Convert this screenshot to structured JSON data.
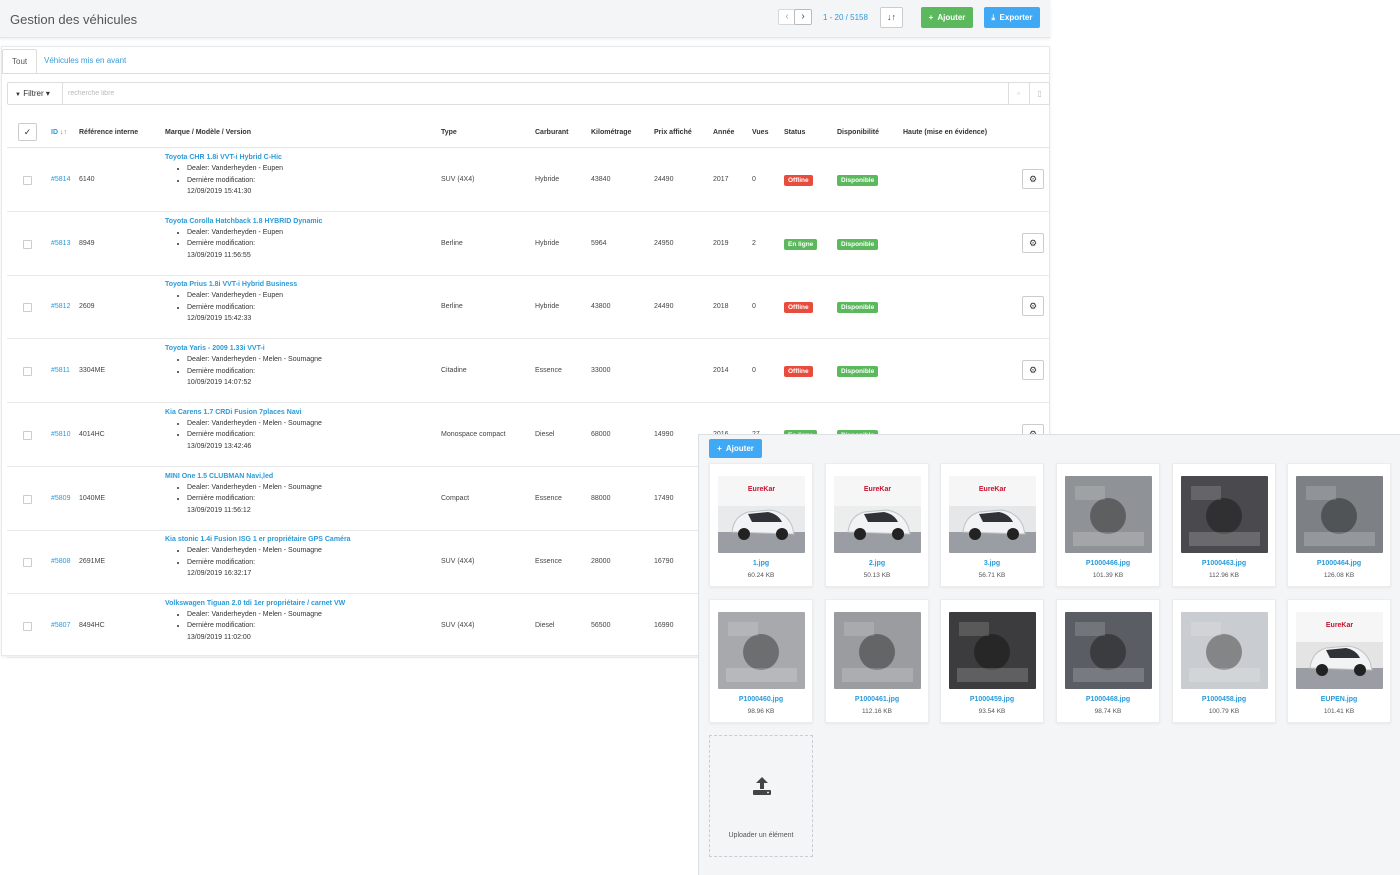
{
  "header": {
    "title": "Gestion des véhicules",
    "prev_icon": "chevron-left-icon",
    "next_icon": "chevron-right-icon",
    "prev_glyph": "‹",
    "next_glyph": "›",
    "pager_text": "1 - 20 / 5158",
    "sort_glyph": "↓↑",
    "add_label": "Ajouter",
    "export_label": "Exporter",
    "add_glyph": "+",
    "export_glyph": "⤓",
    "colors": {
      "green": "#5cb85c",
      "blue": "#3fa9f5",
      "link": "#2b9ad8",
      "red": "#e84c3d"
    }
  },
  "tabs": [
    {
      "label": "Tout",
      "active": true
    },
    {
      "label": "Véhicules mis en avant",
      "active": false
    }
  ],
  "filter": {
    "button_label": "Filtrer",
    "filter_glyph": "▼",
    "caret": "▾",
    "placeholder": "recherche libre",
    "save_glyph": "▫",
    "trash_glyph": "▯"
  },
  "table": {
    "check_glyph": "✓",
    "columns": {
      "id": "ID",
      "id_sort": "↓↑",
      "ref": "Référence interne",
      "model": "Marque / Modèle / Version",
      "type": "Type",
      "fuel": "Carburant",
      "km": "Kilométrage",
      "price": "Prix affiché",
      "year": "Année",
      "views": "Vues",
      "status": "Status",
      "dispo": "Disponibilité",
      "haute": "Haute (mise en évidence)"
    },
    "dealer_prefix": "Dealer: ",
    "modif_label": "Dernière modification:",
    "gear_glyph": "⚙",
    "rows": [
      {
        "id": "#5814",
        "ref": "6140",
        "title": "Toyota CHR 1.8i VVT-i Hybrid C-Hic",
        "dealer": "Vanderheyden - Eupen",
        "date": "12/09/2019 15:41:30",
        "type": "SUV (4X4)",
        "fuel": "Hybride",
        "km": "43840",
        "price": "24490",
        "year": "2017",
        "views": "0",
        "status": "Offline",
        "status_on": false,
        "dispo": "Disponible"
      },
      {
        "id": "#5813",
        "ref": "8949",
        "title": "Toyota Corolla Hatchback 1.8 HYBRID Dynamic",
        "dealer": "Vanderheyden - Eupen",
        "date": "13/09/2019 11:56:55",
        "type": "Berline",
        "fuel": "Hybride",
        "km": "5964",
        "price": "24950",
        "year": "2019",
        "views": "2",
        "status": "En ligne",
        "status_on": true,
        "dispo": "Disponible"
      },
      {
        "id": "#5812",
        "ref": "2609",
        "title": "Toyota Prius 1.8i VVT-i Hybrid Business",
        "dealer": "Vanderheyden - Eupen",
        "date": "12/09/2019 15:42:33",
        "type": "Berline",
        "fuel": "Hybride",
        "km": "43800",
        "price": "24490",
        "year": "2018",
        "views": "0",
        "status": "Offline",
        "status_on": false,
        "dispo": "Disponible"
      },
      {
        "id": "#5811",
        "ref": "3304ME",
        "title": "Toyota Yaris - 2009 1.33i VVT-i",
        "dealer": "Vanderheyden - Melen - Soumagne",
        "date": "10/09/2019 14:07:52",
        "type": "Citadine",
        "fuel": "Essence",
        "km": "33000",
        "price": "",
        "year": "2014",
        "views": "0",
        "status": "Offline",
        "status_on": false,
        "dispo": "Disponible"
      },
      {
        "id": "#5810",
        "ref": "4014HC",
        "title": "Kia Carens 1.7 CRDi Fusion 7places Navi",
        "dealer": "Vanderheyden - Melen - Soumagne",
        "date": "13/09/2019 13:42:46",
        "type": "Monospace compact",
        "fuel": "Diesel",
        "km": "68000",
        "price": "14990",
        "year": "2016",
        "views": "27",
        "status": "En ligne",
        "status_on": true,
        "dispo": "Disponible"
      },
      {
        "id": "#5809",
        "ref": "1040ME",
        "title": "MINI One 1.5 CLUBMAN Navi,led",
        "dealer": "Vanderheyden - Melen - Soumagne",
        "date": "13/09/2019 11:56:12",
        "type": "Compact",
        "fuel": "Essence",
        "km": "88000",
        "price": "17490",
        "year": "",
        "views": "",
        "status": "",
        "status_on": true,
        "dispo": ""
      },
      {
        "id": "#5808",
        "ref": "2691ME",
        "title": "Kia stonic 1.4i Fusion ISG 1 er propriétaire GPS Caméra",
        "dealer": "Vanderheyden - Melen - Soumagne",
        "date": "12/09/2019 16:32:17",
        "type": "SUV (4X4)",
        "fuel": "Essence",
        "km": "28000",
        "price": "16790",
        "year": "",
        "views": "",
        "status": "",
        "status_on": true,
        "dispo": ""
      },
      {
        "id": "#5807",
        "ref": "8494HC",
        "title": "Volkswagen Tiguan 2.0 tdi 1er propriétaire / carnet VW",
        "dealer": "Vanderheyden - Melen - Soumagne",
        "date": "13/09/2019 11:02:00",
        "type": "SUV (4X4)",
        "fuel": "Diesel",
        "km": "56500",
        "price": "16990",
        "year": "",
        "views": "",
        "status": "",
        "status_on": true,
        "dispo": ""
      }
    ]
  },
  "media": {
    "add_label": "Ajouter",
    "add_glyph": "+",
    "upload_label": "Uploader un élément",
    "brand_label": "EureKar",
    "files": [
      {
        "name": "1.jpg",
        "size": "60.24 KB",
        "kind": "car-front",
        "tone": "#e9eaec"
      },
      {
        "name": "2.jpg",
        "size": "50.13 KB",
        "kind": "car-side",
        "tone": "#eceded"
      },
      {
        "name": "3.jpg",
        "size": "56.71 KB",
        "kind": "car-rear",
        "tone": "#e6e7e9"
      },
      {
        "name": "P1000466.jpg",
        "size": "101.39 KB",
        "kind": "interior",
        "tone": "#8f9296"
      },
      {
        "name": "P1000463.jpg",
        "size": "112.96 KB",
        "kind": "dashboard",
        "tone": "#4a4a4e"
      },
      {
        "name": "P1000464.jpg",
        "size": "126.08 KB",
        "kind": "interior",
        "tone": "#7d8186"
      },
      {
        "name": "P1000460.jpg",
        "size": "98.96 KB",
        "kind": "seats",
        "tone": "#a7a9ac"
      },
      {
        "name": "P1000461.jpg",
        "size": "112.16 KB",
        "kind": "seats",
        "tone": "#9a9c9f"
      },
      {
        "name": "P1000459.jpg",
        "size": "93.54 KB",
        "kind": "trunk",
        "tone": "#3c3c3e"
      },
      {
        "name": "P1000468.jpg",
        "size": "98.74 KB",
        "kind": "detail",
        "tone": "#5a5d63"
      },
      {
        "name": "P1000458.jpg",
        "size": "100.79 KB",
        "kind": "front",
        "tone": "#c9ccd0"
      },
      {
        "name": "EUPEN.jpg",
        "size": "101.41 KB",
        "kind": "card",
        "tone": "#e4e4e4"
      }
    ]
  }
}
